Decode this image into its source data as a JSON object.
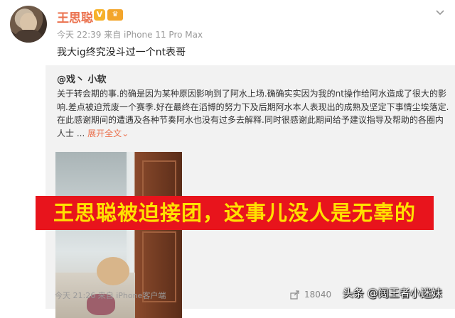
{
  "post": {
    "username": "王思聪",
    "v_badge": "V",
    "member_badge": "♛",
    "meta": "今天 22:39 来自 iPhone 11 Pro Max",
    "text": "我大ig终究没斗过一个nt表哥"
  },
  "repost": {
    "original_user": "@戏丶 小软",
    "text": "关于转会期的事.的确是因为某种原因影响到了阿水上场.确确实实因为我的nt操作给阿水造成了很大的影响.差点被迫荒废一个赛季.好在最终在滔博的努力下及后期阿水本人表现出的成熟及坚定下事情尘埃落定.在此感谢期间的遭遇及各种节奏阿水也没有过多去解释.同时很感谢此期间给予建议指导及帮助的各圈内人士 ...",
    "expand_label": "展开全文",
    "expand_chevron": "⌄",
    "banner_text": "王思聪被迫接团，这事儿没人是无辜的",
    "meta": "今天 21:26 来自 iPhone客户端",
    "share_count": "18040"
  },
  "watermark": "头条 @阔王者小迷妹",
  "icons": [
    "avatar",
    "chevron-down-icon",
    "share-icon"
  ],
  "colors": {
    "accent": "#eb7350",
    "banner_bg": "#e8141c",
    "banner_text": "#ffe100",
    "repost_bg": "#f2f2f2"
  }
}
